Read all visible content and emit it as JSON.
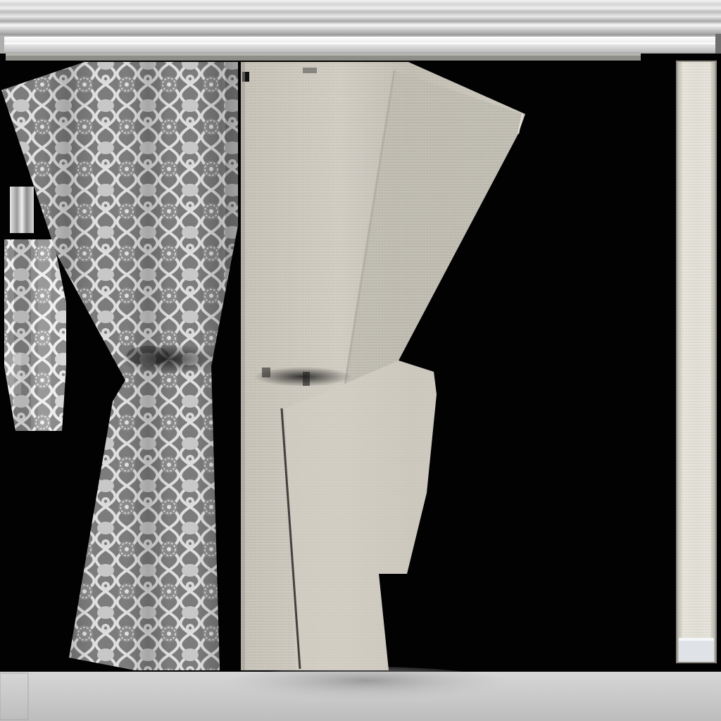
{
  "image": {
    "kind": "uv-texture-atlas",
    "subject": "curtain-fabric",
    "colors": {
      "background": "#020202",
      "rail_light": "#f2f2f2",
      "rail_mid": "#c9c9c9",
      "rail_dark": "#8d8d8d",
      "patterned_fabric": "#7c7c7c",
      "pattern_line": "#eeeeee",
      "pattern_fill": "#d4d4d4",
      "pattern_dark": "#6a6a6a",
      "linen": "#cfcbc0",
      "linen_shade": "#b6b2a8",
      "linen_light": "#e8e5dc",
      "floor_strip": "#c8c8c8",
      "floor_shadow": "#9a9a9a"
    }
  }
}
